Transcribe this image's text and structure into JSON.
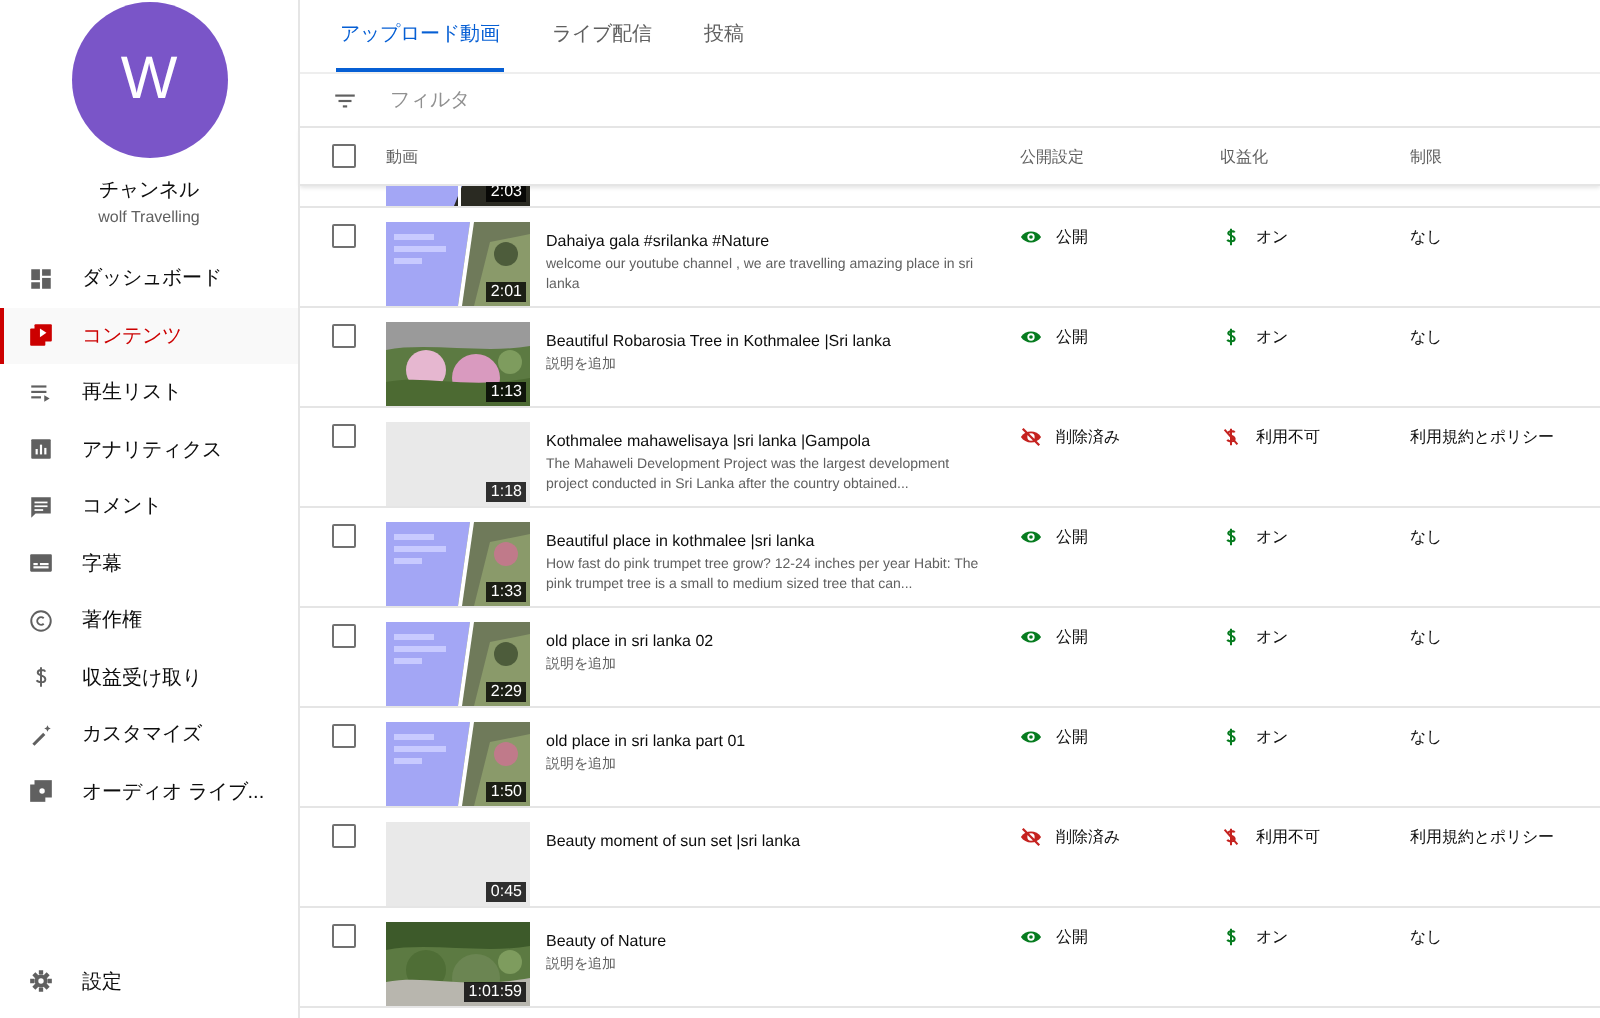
{
  "channel": {
    "initial": "W",
    "label": "チャンネル",
    "name": "wolf Travelling"
  },
  "nav": [
    {
      "label": "ダッシュボード",
      "kind": "dashboard",
      "selected": false
    },
    {
      "label": "コンテンツ",
      "kind": "content",
      "selected": true
    },
    {
      "label": "再生リスト",
      "kind": "playlist",
      "selected": false
    },
    {
      "label": "アナリティクス",
      "kind": "analytics",
      "selected": false
    },
    {
      "label": "コメント",
      "kind": "comment",
      "selected": false
    },
    {
      "label": "字幕",
      "kind": "subtitles",
      "selected": false
    },
    {
      "label": "著作権",
      "kind": "copyright",
      "selected": false
    },
    {
      "label": "収益受け取り",
      "kind": "dollar",
      "selected": false
    },
    {
      "label": "カスタマイズ",
      "kind": "wand",
      "selected": false
    },
    {
      "label": "オーディオ ライブ...",
      "kind": "library",
      "selected": false
    }
  ],
  "settings": {
    "label": "設定"
  },
  "tabs": [
    {
      "label": "アップロード動画",
      "selected": true
    },
    {
      "label": "ライブ配信",
      "selected": false
    },
    {
      "label": "投稿",
      "selected": false
    }
  ],
  "filter": {
    "placeholder": "フィルタ"
  },
  "table": {
    "columns": [
      "動画",
      "公開設定",
      "収益化",
      "制限"
    ],
    "header_checkbox": {
      "checked": false
    },
    "partial_row": {
      "thumbnail": {
        "kind": "graphic",
        "duration": "2:03"
      }
    },
    "rows": [
      {
        "checked": false,
        "thumbnail": {
          "kind": "graphic",
          "duration": "2:01"
        },
        "title": "Dahaiya gala #srilanka #Nature",
        "description": "welcome our youtube channel , we are travelling amazing place in sri lanka",
        "visibility": {
          "kind": "public",
          "label": "公開"
        },
        "monetization": {
          "kind": "on",
          "label": "オン"
        },
        "restriction": "なし"
      },
      {
        "checked": false,
        "thumbnail": {
          "duration": "1:13"
        },
        "title": "Beautiful Robarosia Tree in Kothmalee |Sri lanka",
        "description": "説明を追加",
        "visibility": {
          "kind": "public",
          "label": "公開"
        },
        "monetization": {
          "kind": "on",
          "label": "オン"
        },
        "restriction": "なし"
      },
      {
        "checked": false,
        "thumbnail": {
          "kind": "blank",
          "duration": "1:18"
        },
        "title": "Kothmalee mahawelisaya |sri lanka |Gampola",
        "description": "The Mahaweli Development Project was the largest development project conducted in Sri Lanka after the country obtained...",
        "visibility": {
          "kind": "removed",
          "label": "削除済み"
        },
        "monetization": {
          "kind": "unavailable",
          "label": "利用不可"
        },
        "restriction": "利用規約とポリシー"
      },
      {
        "checked": false,
        "thumbnail": {
          "kind": "graphic",
          "duration": "1:33"
        },
        "title": "Beautiful place in kothmalee |sri lanka",
        "description": "How fast do pink trumpet tree grow? 12-24 inches per year Habit: The pink trumpet tree is a small to medium sized tree that can...",
        "visibility": {
          "kind": "public",
          "label": "公開"
        },
        "monetization": {
          "kind": "on",
          "label": "オン"
        },
        "restriction": "なし"
      },
      {
        "checked": false,
        "thumbnail": {
          "kind": "graphic",
          "duration": "2:29"
        },
        "title": "old place in sri lanka 02",
        "description": "説明を追加",
        "visibility": {
          "kind": "public",
          "label": "公開"
        },
        "monetization": {
          "kind": "on",
          "label": "オン"
        },
        "restriction": "なし"
      },
      {
        "checked": false,
        "thumbnail": {
          "kind": "graphic",
          "duration": "1:50"
        },
        "title": "old place in sri lanka part 01",
        "description": "説明を追加",
        "visibility": {
          "kind": "public",
          "label": "公開"
        },
        "monetization": {
          "kind": "on",
          "label": "オン"
        },
        "restriction": "なし"
      },
      {
        "checked": false,
        "thumbnail": {
          "kind": "blank",
          "duration": "0:45"
        },
        "title": "Beauty moment of sun set |sri lanka",
        "visibility": {
          "kind": "removed",
          "label": "削除済み"
        },
        "monetization": {
          "kind": "unavailable",
          "label": "利用不可"
        },
        "restriction": "利用規約とポリシー"
      },
      {
        "checked": false,
        "thumbnail": {
          "duration": "1:01:59"
        },
        "title": "Beauty of Nature",
        "description": "説明を追加",
        "visibility": {
          "kind": "public",
          "label": "公開"
        },
        "monetization": {
          "kind": "on",
          "label": "オン"
        },
        "restriction": "なし"
      }
    ]
  }
}
